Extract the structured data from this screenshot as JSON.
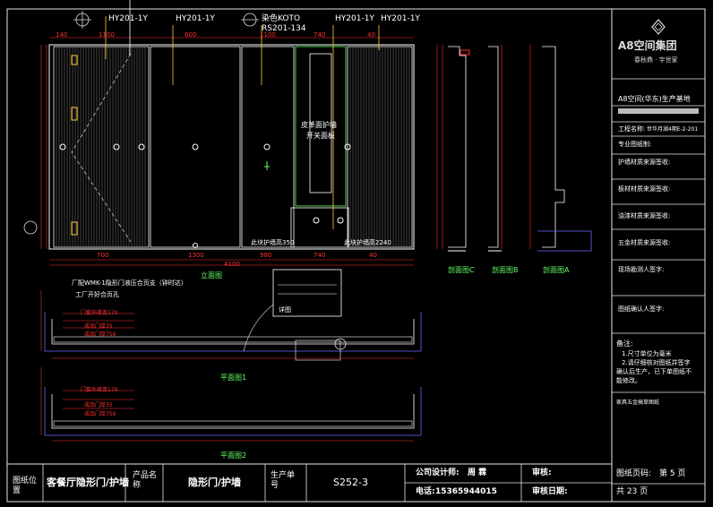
{
  "drawing": {
    "callouts": {
      "hy1": "HY201-1Y",
      "hy2": "HY201-1Y",
      "koto1": "染色KOTO",
      "koto2": "RS201-134",
      "hy3": "HY201-1Y",
      "hy4": "HY201-1Y"
    },
    "door_label_1": "皮革面护墙",
    "door_label_2": "开关面板",
    "bottom_note_1": "此块护墙高350",
    "bottom_note_2": "此块护墙高2240",
    "hardware_note_1": "厂配WMK-1隐形门液压合页支（钟时达）",
    "hardware_note_2": "工厂开好合页孔",
    "view_labels": {
      "elevation": "立面图",
      "section_c": "剖面图C",
      "section_b": "剖面图B",
      "section_a": "剖面图A",
      "plan_1": "平面图1",
      "plan_2": "平面图2"
    },
    "detail_label": "详图",
    "dims_top": [
      "140",
      "1100",
      "600",
      "1100",
      "740",
      "40"
    ],
    "dims_bottom": [
      "700",
      "1300",
      "980",
      "740",
      "40"
    ],
    "dim_total": "4100",
    "plan1_dims": [
      "门套外缘宽170",
      "成品门厚35",
      "成品门厚756"
    ],
    "plan2_dims": [
      "门套外缘宽170",
      "成品门厚35",
      "成品门厚756"
    ]
  },
  "title_block": {
    "brand_name": "A8空间集团",
    "brand_slogan": "春秋鼎 · 宇世家",
    "project_title": "A8空间(华东)生产基地",
    "project_label": "工程名称:",
    "project_value": "世华月湖4期E-2-201",
    "fields": [
      "专业图纸制:",
      "护墙材质来源签收:",
      "板材材质来源签收:",
      "油漆材质来源签收:",
      "五金材质来源签收:",
      "现场勘测人签字:",
      "图纸确认人签字:"
    ],
    "notes_title": "备注:",
    "notes": [
      "1.尺寸单位为毫米",
      "2.请仔细核对图纸并签字",
      "确认后生产，已下单图纸不",
      "能修改。"
    ],
    "notes_footer": "家具五金搞草图纸"
  },
  "footer": {
    "drawing_name_label": "图纸位置",
    "drawing_name_value": "客餐厅隐形门/护墙",
    "product_label": "产品名称",
    "product_value": "隐形门/护墙",
    "order_label": "生产单号",
    "order_value": "S252-3",
    "designer_label": "公司设计师:",
    "designer_value": "周 霖",
    "phone_label": "电话:",
    "phone_value": "15365944015",
    "review_label": "审核:",
    "review_date_label": "审核日期:",
    "page_label": "图纸页码:",
    "page_value": "第 5 页",
    "total_value": "共 23 页"
  }
}
